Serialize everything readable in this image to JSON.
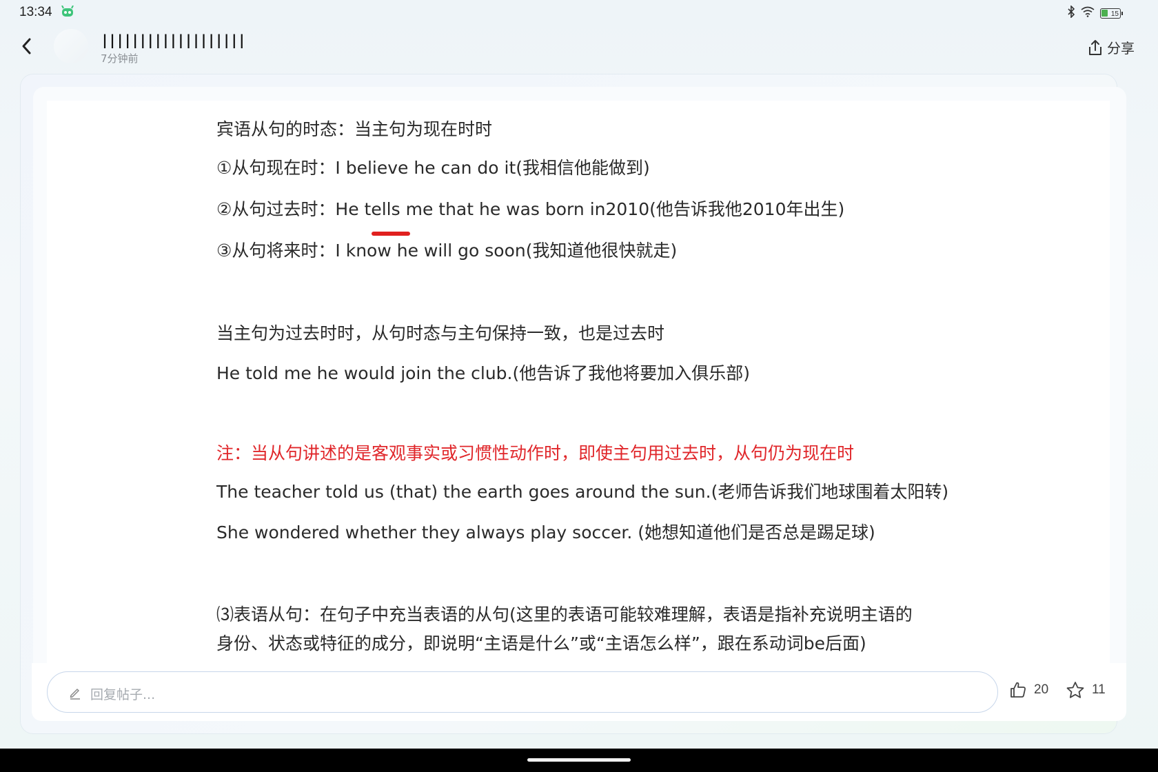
{
  "status_bar": {
    "time": "13:34",
    "battery": "15",
    "icons": [
      "app-robot-icon",
      "bluetooth-icon",
      "wifi-icon",
      "battery-icon"
    ]
  },
  "header": {
    "username": "|||||||||||||||||||",
    "post_time": "7分钟前",
    "share_label": "分享"
  },
  "article": {
    "lines": [
      "宾语从句的时态：当主句为现在时时",
      "①从句现在时：I believe he can do it(我相信他能做到)",
      "②从句过去时：He tells me that he was born in2010(他告诉我他2010年出生)",
      "③从句将来时：I know he will go soon(我知道他很快就走)",
      "当主句为过去时时，从句时态与主句保持一致，也是过去时",
      "He told me he would join the club.(他告诉了我他将要加入俱乐部)",
      "注：当从句讲述的是客观事实或习惯性动作时，即使主句用过去时，从句仍为现在时",
      "The teacher told us (that) the earth goes around the sun.(老师告诉我们地球围着太阳转)",
      "She wondered whether they always play soccer. (她想知道他们是否总是踢足球)",
      "⑶表语从句：在句子中充当表语的从句(这里的表语可能较难理解，表语是指补充说明主语的",
      "身份、状态或特征的成分，即说明“主语是什么”或“主语怎么样”，跟在系动词be后面)"
    ]
  },
  "reply_bar": {
    "placeholder": "回复帖子...",
    "like_count": "20",
    "favorite_count": "11"
  },
  "colors": {
    "note_red": "#e0262a",
    "text": "#2a2a2a",
    "muted": "#8a8f94"
  }
}
